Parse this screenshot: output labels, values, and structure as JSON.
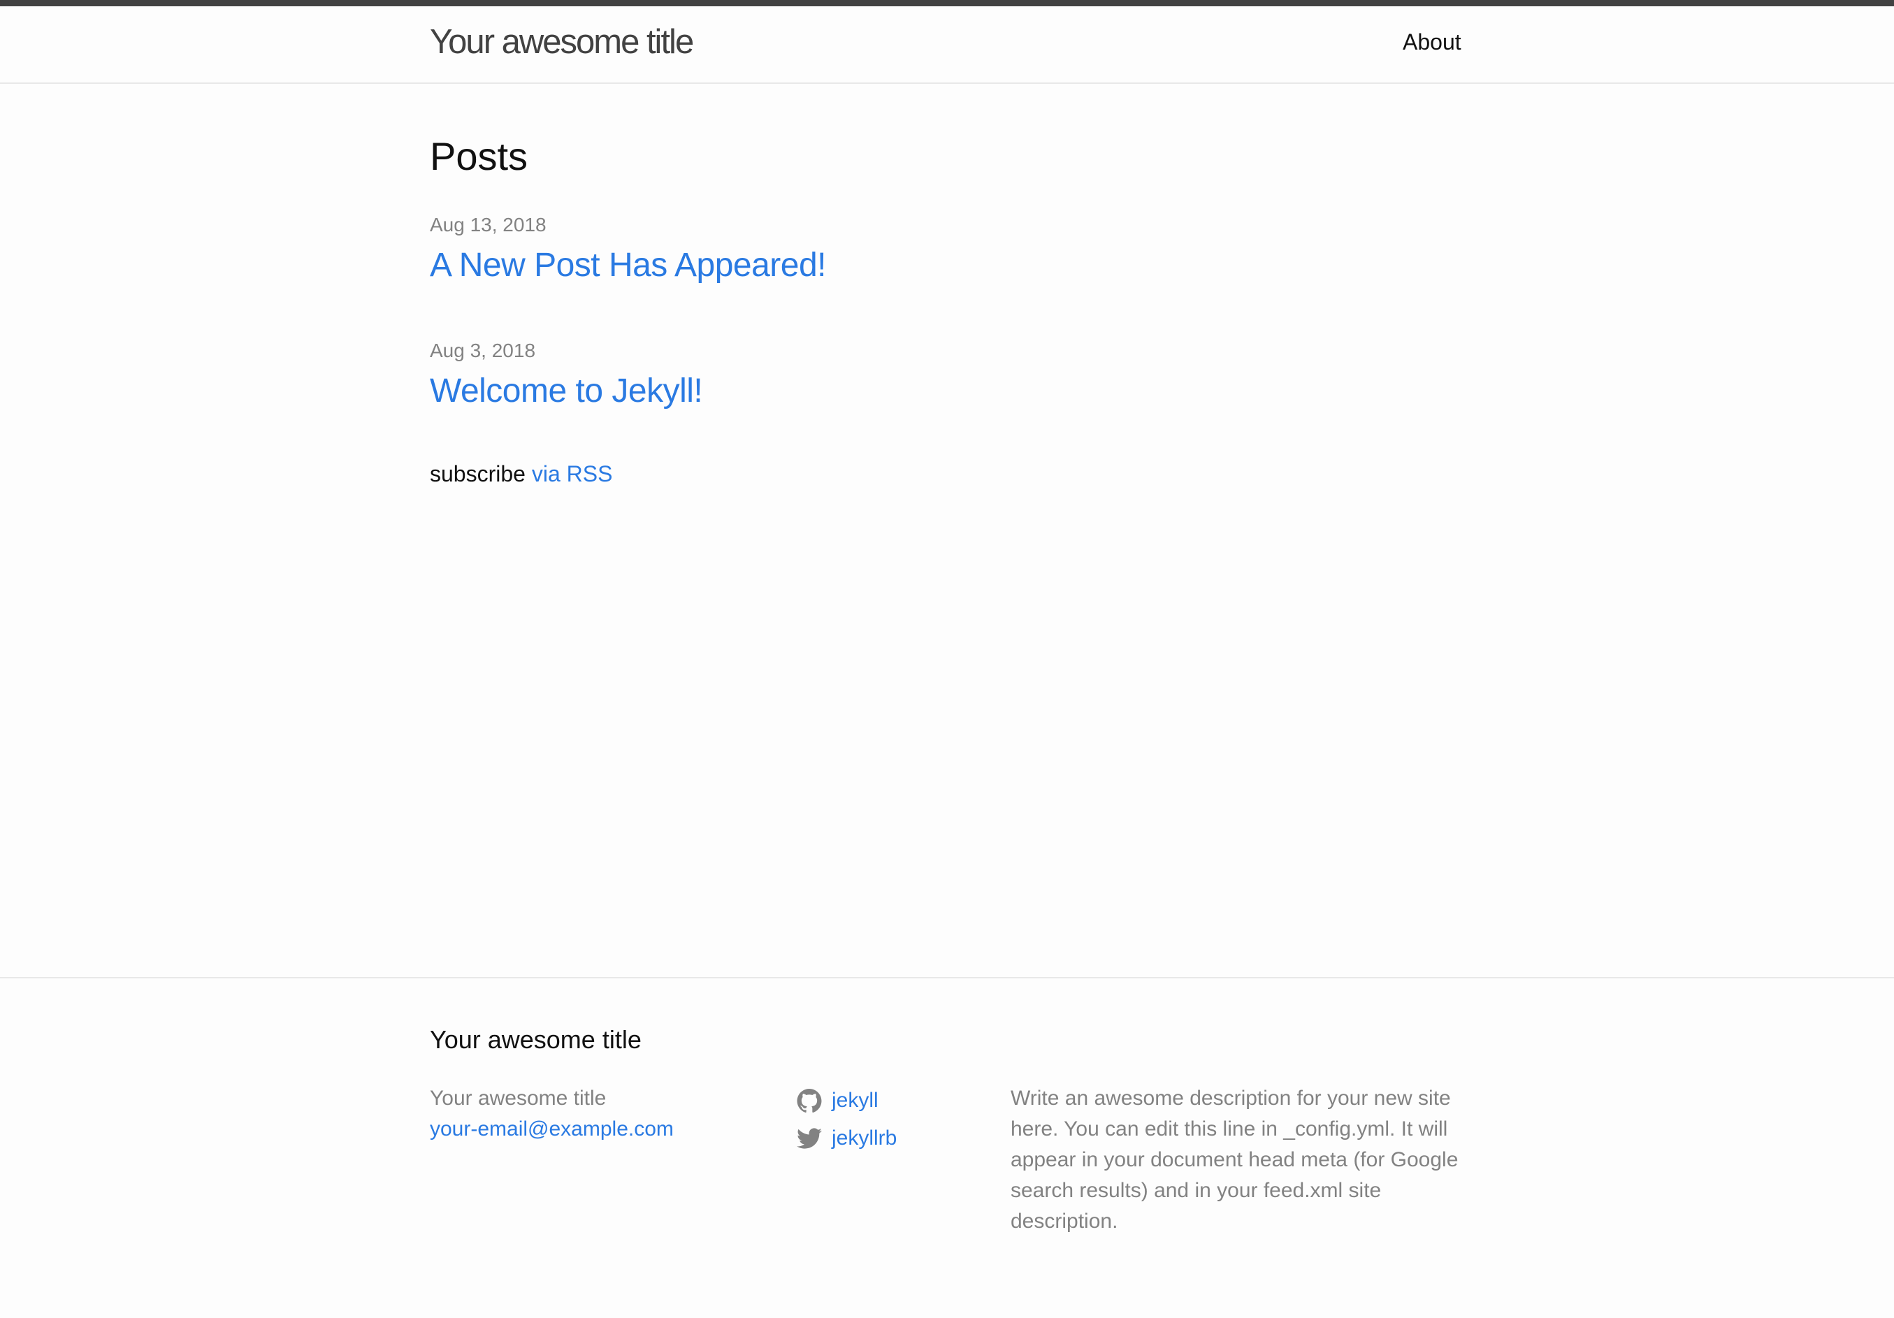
{
  "header": {
    "site_title": "Your awesome title",
    "nav": {
      "about": "About"
    }
  },
  "main": {
    "heading": "Posts",
    "posts": [
      {
        "date": "Aug 13, 2018",
        "title": "A New Post Has Appeared!"
      },
      {
        "date": "Aug 3, 2018",
        "title": "Welcome to Jekyll!"
      }
    ],
    "subscribe": {
      "prefix": "subscribe",
      "link": "via RSS"
    }
  },
  "footer": {
    "heading": "Your awesome title",
    "col1": {
      "name": "Your awesome title",
      "email": "your-email@example.com"
    },
    "social": {
      "github": {
        "label": "jekyll",
        "icon": "github-icon"
      },
      "twitter": {
        "label": "jekyllrb",
        "icon": "twitter-icon"
      }
    },
    "description": "Write an awesome description for your new site here. You can edit this line in _config.yml. It will appear in your document head meta (for Google search results) and in your feed.xml site description."
  },
  "colors": {
    "link": "#2a7ae2",
    "muted": "#828282",
    "text": "#111111",
    "topbar": "#424242",
    "border": "#e8e8e8"
  }
}
